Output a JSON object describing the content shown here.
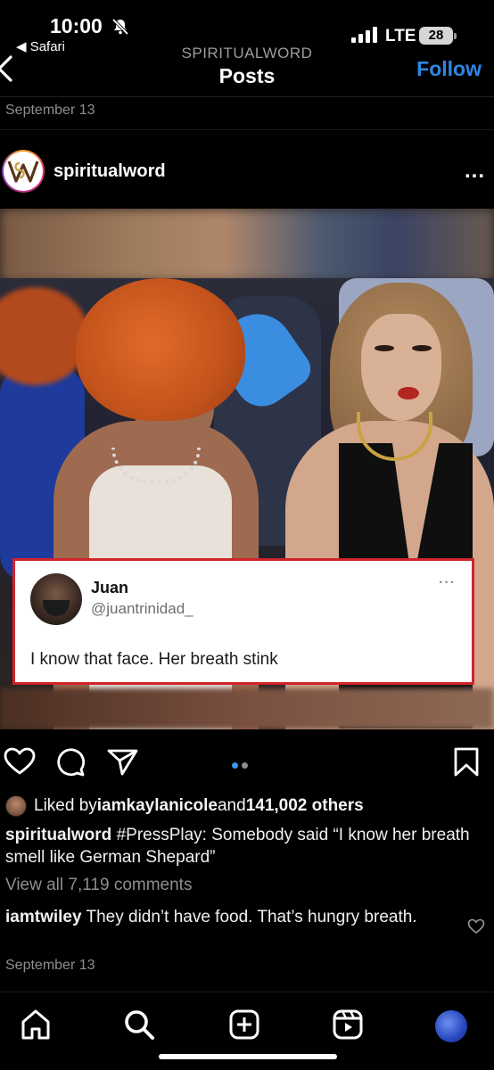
{
  "status_bar": {
    "time": "10:00",
    "back_app": "◀ Safari",
    "network": "LTE",
    "battery": "28"
  },
  "nav": {
    "subtitle": "SPIRITUALWORD",
    "title": "Posts",
    "follow_label": "Follow"
  },
  "post": {
    "date_top": "September 13",
    "username": "spiritualword",
    "avatar_letters": "W",
    "more_icon": "...",
    "tweet": {
      "name": "Juan",
      "handle": "@juantrinidad_",
      "more": "···",
      "text": "I know that face. Her breath stink"
    },
    "carousel": {
      "count": 2,
      "active": 0,
      "active_color": "#3897f0",
      "inactive_color": "#8e8e8e"
    },
    "likes": {
      "prefix": "Liked by ",
      "user": "iamkaylanicole",
      "middle": " and ",
      "count": "141,002 others"
    },
    "caption": {
      "user": "spiritualword",
      "text": " #PressPlay: Somebody said “I know her breath smell like German Shepard”"
    },
    "view_comments": "View all 7,119 comments",
    "comment": {
      "user": "iamtwiley",
      "text": " They didn’t have food. That’s hungry breath."
    },
    "date_bottom": "September 13"
  },
  "tabbar": {
    "items": [
      "home-icon",
      "search-icon",
      "create-icon",
      "reels-icon",
      "profile-avatar"
    ]
  },
  "colors": {
    "accent": "#2f86e6",
    "background": "#000000",
    "tweet_border": "#d3232a"
  }
}
